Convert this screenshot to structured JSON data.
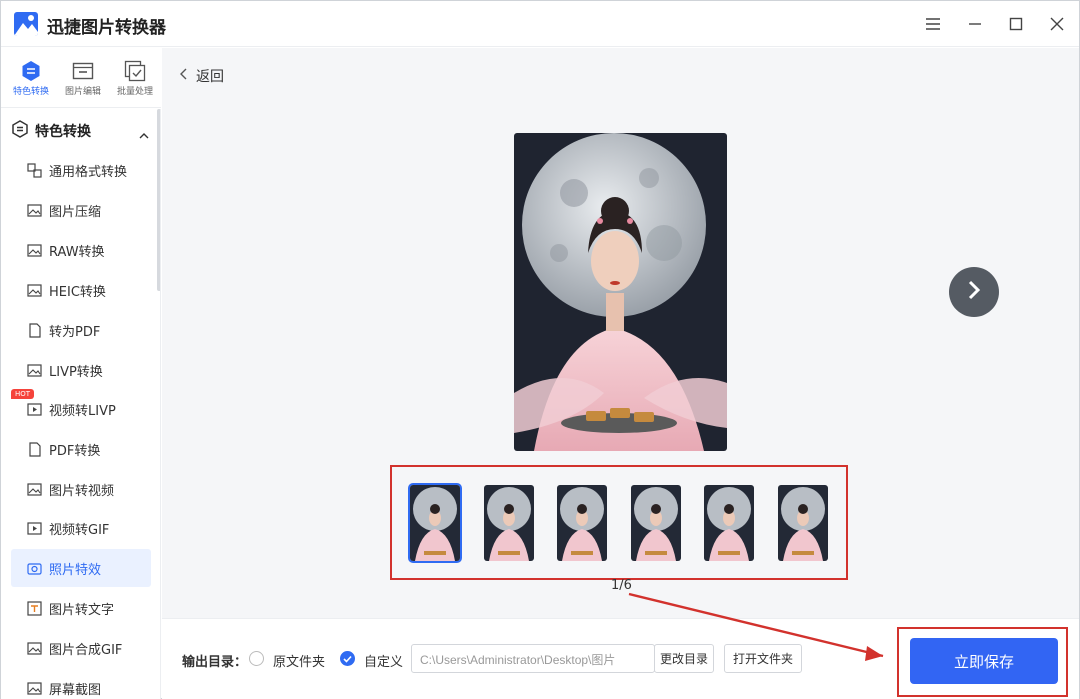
{
  "app": {
    "title": "迅捷图片转换器"
  },
  "rail_tabs": [
    {
      "label": "特色转换",
      "icon": "convert-icon",
      "active": true
    },
    {
      "label": "图片编辑",
      "icon": "edit-icon",
      "active": false
    },
    {
      "label": "批量处理",
      "icon": "batch-icon",
      "active": false
    }
  ],
  "menu": {
    "header": "特色转换",
    "items": [
      "通用格式转换",
      "图片压缩",
      "RAW转换",
      "HEIC转换",
      "转为PDF",
      "LIVP转换",
      "视频转LIVP",
      "PDF转换",
      "图片转视频",
      "视频转GIF",
      "照片特效",
      "图片转文字",
      "图片合成GIF",
      "屏幕截图"
    ],
    "active_item": "照片特效",
    "hot_badge": "HOT"
  },
  "main": {
    "back_label": "返回",
    "pager": "1/6",
    "thumbnail_count": 6,
    "selected_thumbnail": 1
  },
  "bottom": {
    "output_label": "输出目录：",
    "option_original": "原文件夹",
    "option_custom": "自定义",
    "path_value": "C:\\Users\\Administrator\\Desktop\\图片",
    "change_dir": "更改目录",
    "open_folder": "打开文件夹",
    "save_now": "立即保存"
  },
  "colors": {
    "accent": "#2f6bf2",
    "annotation": "#d2322d"
  }
}
